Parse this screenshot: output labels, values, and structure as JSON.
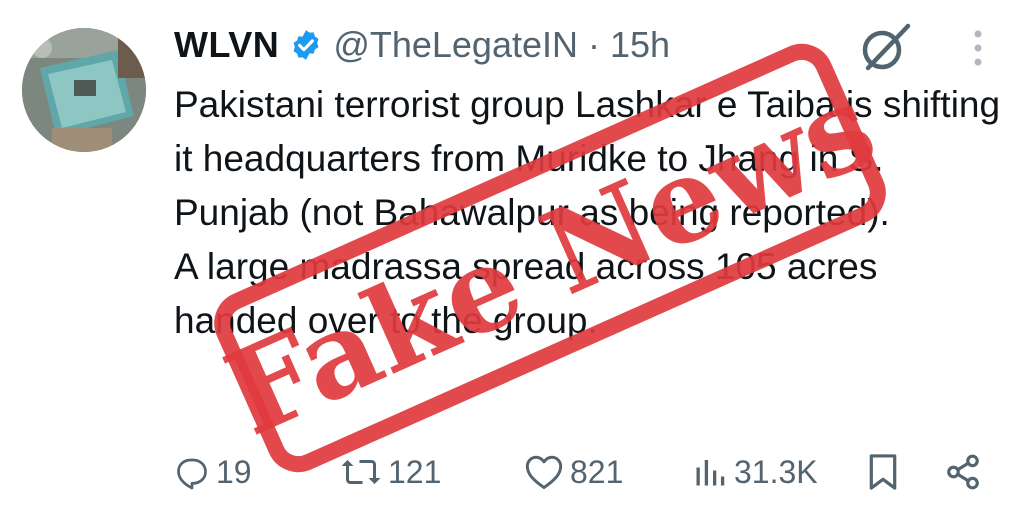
{
  "author": {
    "display_name": "WLVN",
    "handle": "@TheLegateIN",
    "separator": "·",
    "time": "15h"
  },
  "tweet": {
    "paragraph_1": "Pakistani terrorist group Lashkar e Taiba is shifting it headquarters from Muridke to Jhang in S. Punjab (not Bahawalpur as being reported).",
    "paragraph_2": "A large madrassa spread across 105 acres handed over to the group."
  },
  "stats": {
    "replies": "19",
    "reposts": "121",
    "likes": "821",
    "views": "31.3K"
  },
  "stamp": {
    "text": "Fake News",
    "color": "#e03a3e"
  },
  "icons": {
    "verified": "verified-badge-icon",
    "grok": "grok-icon",
    "more": "more-vertical-icon",
    "reply": "reply-icon",
    "repost": "repost-icon",
    "like": "heart-icon",
    "views": "views-icon",
    "bookmark": "bookmark-icon",
    "share": "share-icon"
  },
  "colors": {
    "text": "#0f1419",
    "secondary": "#536471",
    "verified_blue": "#1d9bf0"
  }
}
